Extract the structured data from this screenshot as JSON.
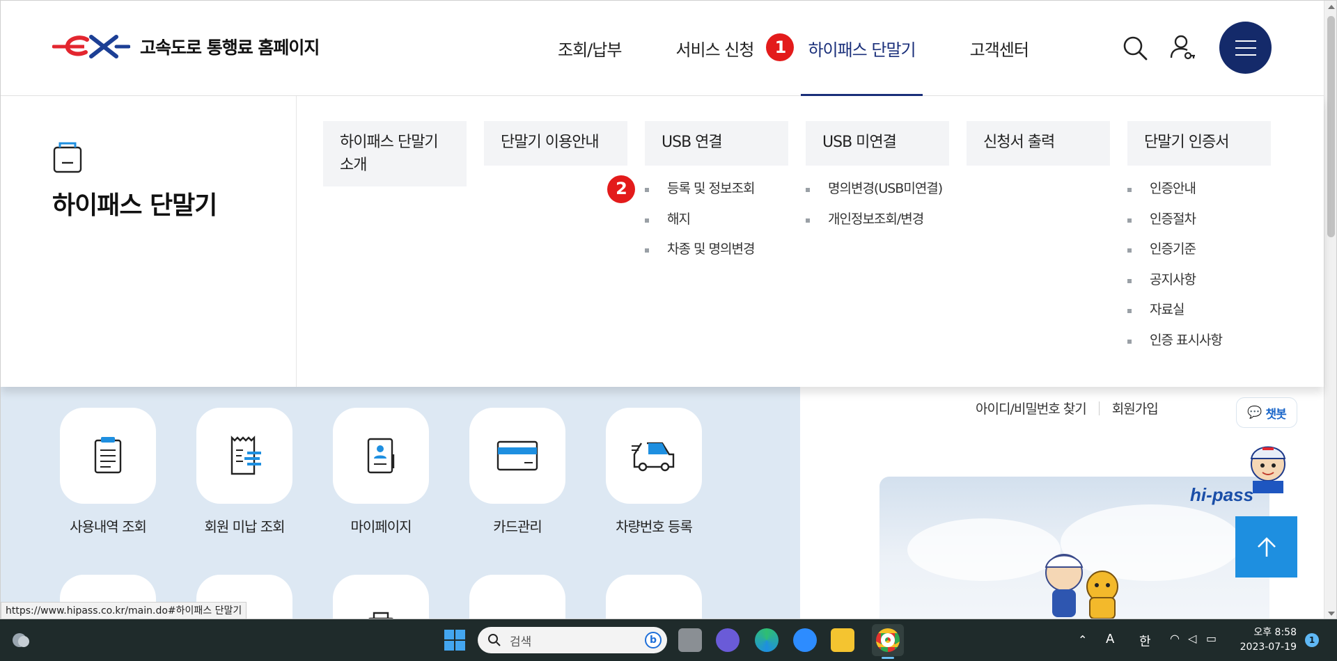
{
  "header": {
    "site_title": "고속도로 통행료 홈페이지",
    "logo_text": "ex",
    "nav": [
      {
        "label": "조회/납부"
      },
      {
        "label": "서비스 신청"
      },
      {
        "label": "하이패스 단말기",
        "badge": "1"
      },
      {
        "label": "고객센터"
      }
    ]
  },
  "mega_menu": {
    "title": "하이패스 단말기",
    "columns": [
      {
        "heading": "하이패스 단말기 소개",
        "items": []
      },
      {
        "heading": "단말기 이용안내",
        "items": []
      },
      {
        "heading": "USB 연결",
        "badge": "2",
        "items": [
          "등록 및 정보조회",
          "해지",
          "차종 및 명의변경"
        ]
      },
      {
        "heading": "USB 미연결",
        "items": [
          "명의변경(USB미연결)",
          "개인정보조회/변경"
        ]
      },
      {
        "heading": "신청서 출력",
        "items": []
      },
      {
        "heading": "단말기 인증서",
        "items": [
          "인증안내",
          "인증절차",
          "인증기준",
          "공지사항",
          "자료실",
          "인증 표시사항"
        ]
      }
    ]
  },
  "quick_menu": {
    "items": [
      "사용내역 조회",
      "회원 미납 조회",
      "마이페이지",
      "카드관리",
      "차량번호 등록"
    ]
  },
  "account": {
    "find_label": "아이디/비밀번호 찾기",
    "join_label": "회원가입"
  },
  "chatbot": {
    "label": "챗봇"
  },
  "brand": {
    "hipass_text": "hi-pass"
  },
  "status_url": "https://www.hipass.co.kr/main.do#하이패스 단말기",
  "taskbar": {
    "search_placeholder": "검색",
    "ime_lang": "A",
    "ime_korean": "한",
    "time": "오후 8:58",
    "date": "2023-07-19",
    "notification_count": "1"
  },
  "colors": {
    "navy": "#142a6a",
    "active_nav": "#1a2f7a",
    "badge_red": "#e31b1b",
    "top_button": "#1e8fe0",
    "page_bg": "#dde8f3"
  }
}
